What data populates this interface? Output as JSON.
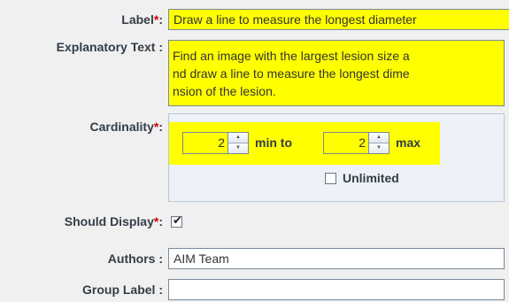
{
  "form": {
    "label": {
      "name": "Label",
      "suffix": ":",
      "value": "Draw a line to measure the longest diameter"
    },
    "explanatory_text": {
      "name": "Explanatory Text :",
      "lines": [
        "Find an image with the largest lesion size a",
        "nd draw a line to measure the longest dime",
        "nsion of the lesion."
      ]
    },
    "cardinality": {
      "name": "Cardinality",
      "suffix": ":",
      "min_value": "2",
      "min_label": "min to",
      "max_value": "2",
      "max_label": "max",
      "unlimited_label": "Unlimited",
      "unlimited_checked": false
    },
    "should_display": {
      "name": "Should Display",
      "suffix": ":",
      "checked": true
    },
    "authors": {
      "name": "Authors :",
      "value": "AIM Team"
    },
    "group_label": {
      "name": "Group Label :",
      "value": ""
    },
    "required_marker": "*",
    "check_glyph": "✔"
  },
  "colors": {
    "highlight": "#ffff00",
    "required": "#d40000",
    "label_text": "#333d47",
    "background": "#f0f0f0"
  }
}
